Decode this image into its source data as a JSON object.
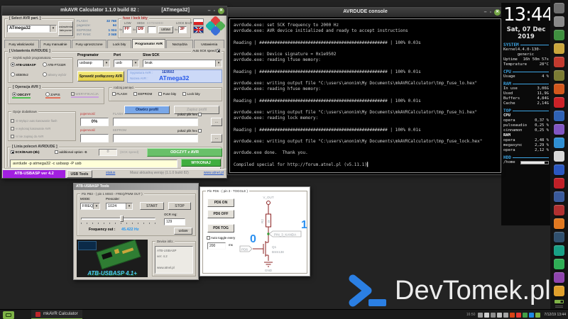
{
  "mkavr": {
    "title": "mkAVR Calculator 1.1.0 build 82 :",
    "title_device": "[ATmega32]",
    "select_group": "[ Select AVR part. ]",
    "part_value": "ATmega32",
    "factory_btn": "ustawienia fabryczne",
    "memory": [
      {
        "k": "FLASH:",
        "v": "32 768"
      },
      {
        "k": "pagesize:",
        "v": "64"
      },
      {
        "k": "EEPROM:",
        "v": "1 024"
      },
      {
        "k": "INT RAM:",
        "v": "2 048"
      }
    ],
    "fuse": {
      "group": "fuse i lock bity",
      "low_label": "LOW",
      "high_label": "HIGH",
      "ext_label": "EXTENDED",
      "lock_label": "LOCK BAJT",
      "hex_prefix": "0x",
      "low": "FF",
      "high": "D9",
      "ext": "",
      "lock": "3F",
      "set_btn": "ustaw"
    },
    "tabs": [
      {
        "label": "Fusy właściwości"
      },
      {
        "label": "Fusy manualnie"
      },
      {
        "label": "Fusy uproszczone"
      },
      {
        "label": "Lock bity"
      },
      {
        "label": "Programator AVR"
      },
      {
        "label": "Narzędzia"
      },
      {
        "label": "Ustawienia"
      }
    ],
    "settings_group": "[ Ustawienia AVRDUDE ]",
    "quick_group": "Szybki wybór programatora",
    "radio_usbasp": "ATB-USBASP",
    "radio_ft232r": "ATB-FT232R",
    "radio_stk500": "stk500v2",
    "radio_custom": "własny wybór",
    "programator_label": "Programator",
    "programator": "usbasp",
    "port_label": "Port",
    "port": "usb",
    "slowsck_label": "Slow SCK",
    "slowsck": "brak",
    "autosck_label": "Auto SCK speed",
    "check_btn": "Sprawdź podłączony AVR",
    "sig_label": "Sygnatura AVR :",
    "sig_value": "1E9502",
    "name_label": "Nazwa AVR :",
    "name_value": "ATmega32",
    "op_group": "[ Operacja AVR ]",
    "op_read": "ODCZYT",
    "op_write": "ZAPIS",
    "op_verify": "WERYFIKACJA",
    "mem_group": "rodzaj pamięci",
    "mem_checks": [
      "FLASH",
      "EEPROM",
      "Fuse bity",
      "Lock bity"
    ],
    "open_profile": "Otwórz profil",
    "save_profile": "Zapisz profil",
    "extra_group": "Opcje dodatkowe",
    "extra_checks": [
      "-D Wyłącz auto kasowanie flash",
      "-e wykonaj kasowanie AVR",
      "-V nie zapisuj do AVR"
    ],
    "cap_label": "pojemność",
    "cap_value": "0%",
    "flash_label": "FLASH",
    "eeprom_label": "EEPROM",
    "show_hex": "pokaż plik hex",
    "browse": "...",
    "cmd_group": "[ Linia poleceń AVRDUDE ]",
    "sck_baud": "SCK/BAUD-(8b)",
    "add_option": "additional option -B",
    "sck_value": "8",
    "sck_speed": "(SCK speed)",
    "read_avr_btn": "ODCZYT z AVR",
    "command": "avrdude -p atmega32 -c usbasp -P usb",
    "execute_btn": "WYKONAJ",
    "reset_btn": "reset",
    "status_ver": "ATB-USBASP ver 4.2",
    "usb_tools_btn": "USB Tools",
    "status_link": "status",
    "version_info": "Masz aktualną wersję (1.1.0 build 82)",
    "site_link": "www.atnel.pl"
  },
  "console": {
    "title": "AVRDUDE console",
    "lines": [
      "avrdude.exe: set SCK frequency to 2000 Hz",
      "avrdude.exe: AVR device initialized and ready to accept instructions",
      "",
      "Reading | ################################################## | 100% 0.03s",
      "",
      "avrdude.exe: Device signature = 0x1e9502",
      "avrdude.exe: reading lfuse memory:",
      "",
      "Reading | ################################################## | 100% 0.01s",
      "",
      "avrdude.exe: writing output file \"C:\\users\\anonim\\My Documents\\mkAVRCalculator\\tmp_fuse_lo.hex\"",
      "avrdude.exe: reading hfuse memory:",
      "",
      "Reading | ################################################## | 100% 0.01s",
      "",
      "avrdude.exe: writing output file \"C:\\users\\anonim\\My Documents\\mkAVRCalculator\\tmp_fuse_hi.hex\"",
      "avrdude.exe: reading lock memory:",
      "",
      "Reading | ################################################## | 100% 0.01s",
      "",
      "avrdude.exe: writing output file \"C:\\users\\anonim\\My Documents\\mkAVRCalculator\\tmp_fuse_lock.hex\"",
      "",
      "avrdude.exe done.  Thank you.",
      "",
      "Compiled special for http://forum.atnel.pl (v5.11.1)"
    ]
  },
  "conky": {
    "time": "13:44",
    "date": "Sat, 07 Dec 2019",
    "system_title": "SYSTEM",
    "system_rows": [
      {
        "k": "Kernel",
        "v": "4.4.0-130-generic"
      },
      {
        "k": "Uptime",
        "v": "16h 50m 57s"
      },
      {
        "k": "Temprature",
        "v": "28°C"
      }
    ],
    "cpu_title": "CPU",
    "cpu_rows": [
      {
        "k": "Usage",
        "v": "4 %"
      }
    ],
    "ram_title": "RAM",
    "ram_rows": [
      {
        "k": "In use",
        "v": "3,06G"
      },
      {
        "k": "Used",
        "v": "11,9G"
      },
      {
        "k": "Buffers",
        "v": "4,84G"
      },
      {
        "k": "Cache",
        "v": "2,14G"
      }
    ],
    "top_title": "TOP",
    "top_cpu_label": "CPU",
    "top_cpu_rows": [
      {
        "k": "opera",
        "v": "0,37 %"
      },
      {
        "k": "pulseaudio",
        "v": "0,25 %"
      },
      {
        "k": "cinnamon",
        "v": "0,25 %"
      }
    ],
    "top_ram_label": "RAM",
    "top_ram_rows": [
      {
        "k": "opera",
        "v": "2,48 %"
      },
      {
        "k": "megasync",
        "v": "2,29 %"
      },
      {
        "k": "opera",
        "v": "2,12 %"
      }
    ],
    "hdd_title": "HDD",
    "hdd_label": "/home"
  },
  "usbasp": {
    "title": "ATB-USBASP Tools",
    "pb3_group": "Pin PB3 - ( pin 1 MISO - FREQ/PWM OUT )",
    "mode_label": "MODE:",
    "mode": "FREQ",
    "prescaler_label": "Prescaler:",
    "prescaler": "1024",
    "start_btn": "START",
    "stop_btn": "STOP",
    "ocr_label": "OCR reg:",
    "ocr_value": "129",
    "ocr_set_btn": "ustaw",
    "freq_label": "Frequency out :",
    "freq_value": "45.422 Hz",
    "promo_text": "ATB-USBASP 4.1+",
    "device_group": "Device info:",
    "device_lines": [
      "ATB-USBASP",
      "ver: 4.2",
      "",
      "www.atnel.pl"
    ]
  },
  "pd6": {
    "group": "Pin PD6 - ( pin 3 - TOGGLE )",
    "on_btn": "PD6 ON",
    "off_btn": "PD6 OFF",
    "tog_btn": "PD6 TOG",
    "auto_label": "Auto toggle every",
    "interval": "200",
    "ms_label": "ms",
    "schematic": {
      "vout": "V_OUT",
      "r_ref": "R2",
      "r_val": "1k",
      "net": "PIN_3_KANDA",
      "one": "1",
      "zero": "0",
      "q_ref": "Q1",
      "q_part": "BSS138",
      "pd6": "PD6",
      "gnd": "GND"
    }
  },
  "logo": {
    "text": "DevTomek.pl",
    "accent": "#2b7fe3"
  },
  "taskbar": {
    "window_button": "mkAVR Calculator",
    "tray_text": "16:50",
    "clock": "7/12/19 13:44",
    "tray_icons": [
      {
        "color": "#9e9e9e"
      },
      {
        "color": "#cfcfcf"
      },
      {
        "color": "#8d8d8d"
      },
      {
        "color": "#bdbdbd"
      },
      {
        "color": "#a5a5a5"
      },
      {
        "color": "#d84315"
      },
      {
        "color": "#e53935"
      },
      {
        "color": "#43a047"
      },
      {
        "color": "#1e88e5"
      },
      {
        "color": "#7cb342"
      }
    ]
  },
  "dock": {
    "icons": [
      {
        "color": "#6d6d6d"
      },
      {
        "color": "#8a8a8a"
      },
      {
        "color": "#3f8f3f"
      },
      {
        "color": "#caa63c"
      },
      {
        "color": "#c23a2e"
      },
      {
        "color": "#7c7c34"
      },
      {
        "color": "#d3571c"
      },
      {
        "color": "#cc2127"
      },
      {
        "color": "#2f62b5"
      },
      {
        "color": "#8156c2"
      },
      {
        "color": "#2f8fd3"
      },
      {
        "color": "#d9d9d9"
      },
      {
        "color": "#2a57c0"
      },
      {
        "color": "#c01f27"
      },
      {
        "color": "#3a5a9b"
      },
      {
        "color": "#b03030"
      },
      {
        "color": "#e07820"
      },
      {
        "color": "#30506e"
      },
      {
        "color": "#18a085"
      },
      {
        "color": "#2fae55"
      },
      {
        "color": "#8e44ad"
      },
      {
        "color": "#e0a02c"
      }
    ]
  }
}
